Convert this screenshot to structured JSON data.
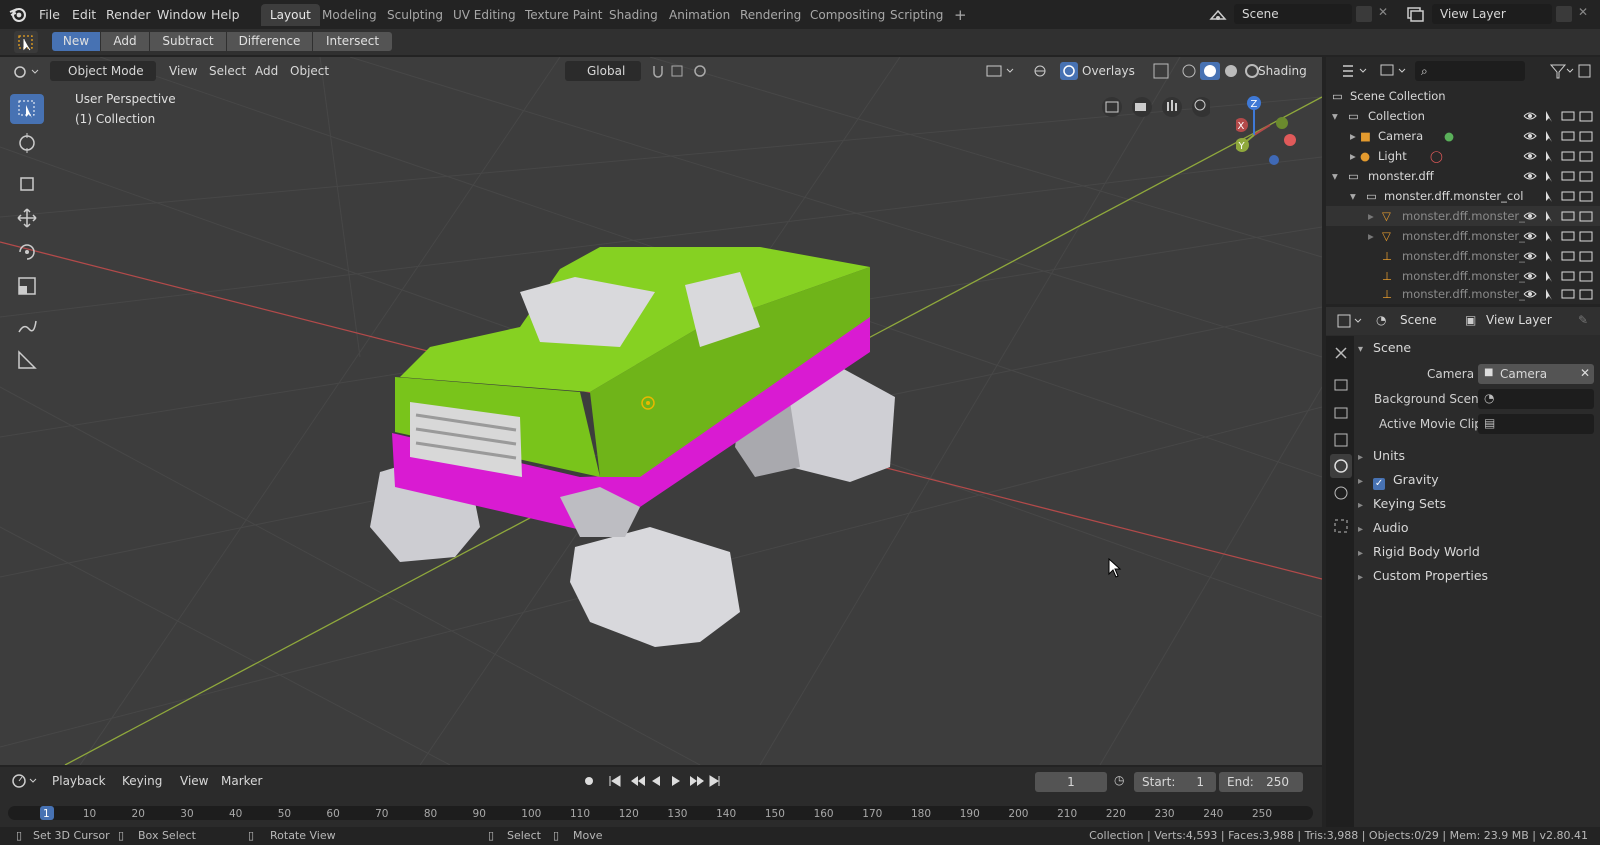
{
  "app": {
    "name": "Blender",
    "version": "v2.80.41"
  },
  "menu": [
    "File",
    "Edit",
    "Render",
    "Window",
    "Help"
  ],
  "workspaces": {
    "tabs": [
      "Layout",
      "Modeling",
      "Sculpting",
      "UV Editing",
      "Texture Paint",
      "Shading",
      "Animation",
      "Rendering",
      "Compositing",
      "Scripting"
    ],
    "active": "Layout",
    "add_symbol": "+"
  },
  "top_right": {
    "scene": "Scene",
    "view_layer": "View Layer"
  },
  "tool_settings": {
    "modes": [
      "New",
      "Add",
      "Subtract",
      "Difference",
      "Intersect"
    ],
    "active": "New"
  },
  "viewport": {
    "mode": "Object Mode",
    "menus": [
      "View",
      "Select",
      "Add",
      "Object"
    ],
    "orientation": "Global",
    "overlays_label": "Overlays",
    "shading_label": "Shading",
    "perspective_label": "User Perspective",
    "collection_label": "(1) Collection",
    "gizmo_axes": [
      "X",
      "Y",
      "Z"
    ],
    "colors": {
      "x_axis": "#b34a4a",
      "y_axis": "#8fa83c",
      "z_axis": "#3f79d6",
      "truck_body": "#79c41b",
      "truck_trim": "#d91bd2",
      "tires": "#d8d8dc"
    }
  },
  "outliner": {
    "root": "Scene Collection",
    "rows": [
      {
        "label": "Collection",
        "level": 0,
        "icon": "collection-icon"
      },
      {
        "label": "Camera",
        "level": 1,
        "icon": "camera-icon"
      },
      {
        "label": "Light",
        "level": 1,
        "icon": "light-icon"
      },
      {
        "label": "monster.dff",
        "level": 0,
        "icon": "collection-icon"
      },
      {
        "label": "monster.dff.monster_col",
        "level": 1,
        "icon": "collection-icon"
      },
      {
        "label": "monster.dff.monster_",
        "level": 2,
        "icon": "mesh-icon"
      },
      {
        "label": "monster.dff.monster_",
        "level": 2,
        "icon": "mesh-icon"
      },
      {
        "label": "monster.dff.monster_",
        "level": 2,
        "icon": "armature-icon"
      },
      {
        "label": "monster.dff.monster_",
        "level": 2,
        "icon": "armature-icon"
      },
      {
        "label": "monster.dff.monster_",
        "level": 2,
        "icon": "armature-icon"
      }
    ]
  },
  "properties": {
    "header_tabs": [
      "Scene",
      "View Layer"
    ],
    "section": "Scene",
    "fields": [
      {
        "label": "Camera",
        "value": "Camera"
      },
      {
        "label": "Background Scene",
        "value": ""
      },
      {
        "label": "Active Movie Clip",
        "value": ""
      }
    ],
    "panels": [
      "Units",
      "Gravity",
      "Keying Sets",
      "Audio",
      "Rigid Body World",
      "Custom Properties"
    ],
    "gravity_checked": true
  },
  "timeline": {
    "menus": [
      "Playback",
      "Keying",
      "View",
      "Marker"
    ],
    "current_frame": "1",
    "start_label": "Start:",
    "start": "1",
    "end_label": "End:",
    "end": "250",
    "ticks": [
      "1",
      "10",
      "20",
      "30",
      "40",
      "50",
      "60",
      "70",
      "80",
      "90",
      "100",
      "110",
      "120",
      "130",
      "140",
      "150",
      "160",
      "170",
      "180",
      "190",
      "200",
      "210",
      "220",
      "230",
      "240",
      "250"
    ]
  },
  "status": {
    "hints": [
      "Set 3D Cursor",
      "Box Select",
      "Rotate View",
      "Select",
      "Move"
    ],
    "stats": "Collection | Verts:4,593 | Faces:3,988 | Tris:3,988 | Objects:0/29 | Mem: 23.9 MB | v2.80.41"
  }
}
